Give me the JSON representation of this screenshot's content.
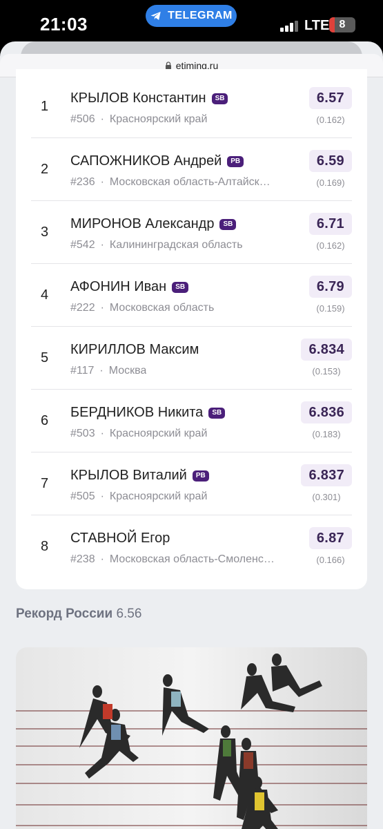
{
  "status_bar": {
    "time": "21:03",
    "telegram_label": "TELEGRAM",
    "network": "LTE",
    "battery": "8"
  },
  "browser": {
    "url": "etiming.ru"
  },
  "results": [
    {
      "place": "1",
      "name": "КРЫЛОВ Константин",
      "badge": "SB",
      "bib": "#506",
      "region": "Красноярский край",
      "result": "6.57",
      "reaction": "(0.162)"
    },
    {
      "place": "2",
      "name": "САПОЖНИКОВ Андрей",
      "badge": "PB",
      "bib": "#236",
      "region": "Московская область-Алтайск…",
      "result": "6.59",
      "reaction": "(0.169)"
    },
    {
      "place": "3",
      "name": "МИРОНОВ Александр",
      "badge": "SB",
      "bib": "#542",
      "region": "Калининградская область",
      "result": "6.71",
      "reaction": "(0.162)"
    },
    {
      "place": "4",
      "name": "АФОНИН Иван",
      "badge": "SB",
      "bib": "#222",
      "region": "Московская область",
      "result": "6.79",
      "reaction": "(0.159)"
    },
    {
      "place": "5",
      "name": "КИРИЛЛОВ Максим",
      "badge": "",
      "bib": "#117",
      "region": "Москва",
      "result": "6.834",
      "reaction": "(0.153)"
    },
    {
      "place": "6",
      "name": "БЕРДНИКОВ Никита",
      "badge": "SB",
      "bib": "#503",
      "region": "Красноярский край",
      "result": "6.836",
      "reaction": "(0.183)"
    },
    {
      "place": "7",
      "name": "КРЫЛОВ Виталий",
      "badge": "PB",
      "bib": "#505",
      "region": "Красноярский край",
      "result": "6.837",
      "reaction": "(0.301)"
    },
    {
      "place": "8",
      "name": "СТАВНОЙ Егор",
      "badge": "",
      "bib": "#238",
      "region": "Московская область-Смоленс…",
      "result": "6.87",
      "reaction": "(0.166)"
    }
  ],
  "record": {
    "label": "Рекорд России",
    "value": "6.56"
  },
  "colors": {
    "badge": "#4b1f7a",
    "result_bg": "#f1ecf7",
    "telegram": "#2f7fe6"
  }
}
